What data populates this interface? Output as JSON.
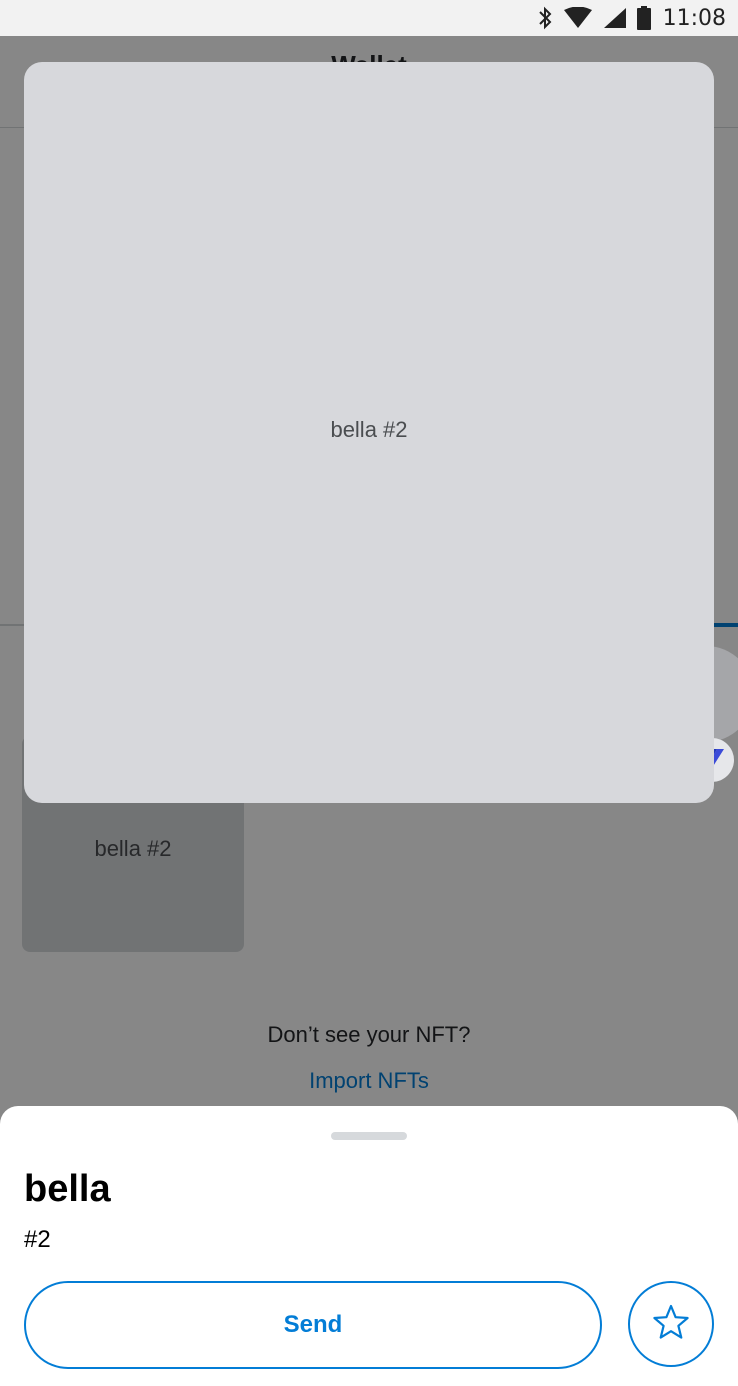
{
  "status_bar": {
    "time": "11:08",
    "icons": [
      "bluetooth-icon",
      "wifi-icon",
      "cell-signal-icon",
      "battery-icon"
    ]
  },
  "background": {
    "header_title": "Wallet",
    "nft_card_label": "bella #2",
    "dont_see_text": "Don’t see your NFT?",
    "import_link": "Import NFTs"
  },
  "preview": {
    "label": "bella #2",
    "next_icon": "chevron-right-icon",
    "badge_icon": "v-logo-icon"
  },
  "sheet": {
    "name": "bella",
    "token_id": "#2",
    "send_label": "Send",
    "favorite_icon": "star-outline-icon"
  },
  "colors": {
    "accent": "#037dd6",
    "preview_bg": "#d7d8dc",
    "overlay": "rgba(0,0,0,0.47)"
  }
}
